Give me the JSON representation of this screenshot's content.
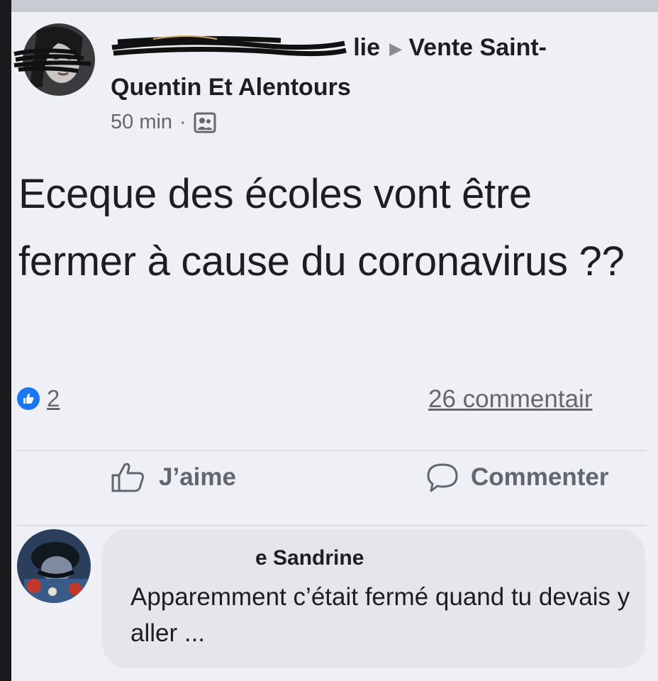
{
  "post": {
    "author_visible_fragment": "lie",
    "group_name": "Vente Saint-Quentin Et Alentours",
    "timestamp": "50 min",
    "separator": "·",
    "text": "Eceque des écoles vont être fermer à cause du coronavirus ??",
    "likes": "2",
    "comments_count": "26 commentair"
  },
  "actions": {
    "like_label": "J’aime",
    "comment_label": "Commenter"
  },
  "comment": {
    "author_visible_fragment": "e Sandrine",
    "text": "Apparemment c’était fermé quand tu devais y aller ..."
  },
  "icons": {
    "arrow": "triangle-right-icon",
    "privacy": "group-members-icon",
    "like_reaction": "thumbs-up-badge-icon",
    "like_action": "thumbs-up-outline-icon",
    "comment_action": "speech-bubble-icon"
  },
  "colors": {
    "background": "#eef0f5",
    "like_blue": "#1877f2",
    "secondary_text": "#65676b",
    "bubble": "#e4e6eb"
  }
}
